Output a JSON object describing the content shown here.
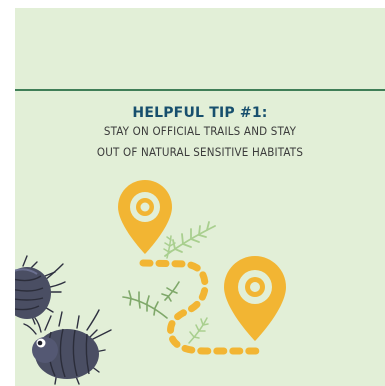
{
  "tip": {
    "title": "HELPFUL TIP #1:",
    "line1": "STAY ON OFFICIAL TRAILS AND STAY",
    "line2": "OUT OF NATURAL SENSITIVE HABITATS"
  },
  "colors": {
    "background": "#e2efd7",
    "divider": "#3f7e57",
    "title": "#174f6d",
    "pin": "#f2b533",
    "leaf": "#a9cf8f",
    "bug": "#4a4e63"
  },
  "icons": [
    "map-pin-icon",
    "map-pin-icon",
    "dashed-trail-path",
    "fern-leaf-icon",
    "pill-bug-illustration"
  ]
}
